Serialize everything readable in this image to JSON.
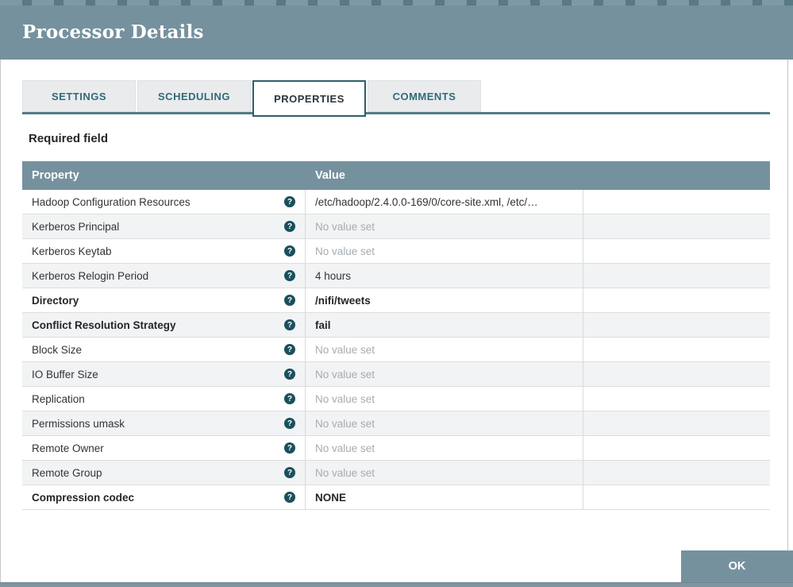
{
  "dialog": {
    "title": "Processor Details",
    "required_note": "Required field",
    "ok_label": "OK"
  },
  "tabs": [
    {
      "label": "SETTINGS",
      "active": false
    },
    {
      "label": "SCHEDULING",
      "active": false
    },
    {
      "label": "PROPERTIES",
      "active": true
    },
    {
      "label": "COMMENTS",
      "active": false
    }
  ],
  "table": {
    "columns": [
      "Property",
      "Value"
    ],
    "rows": [
      {
        "property": "Hadoop Configuration Resources",
        "value": "/etc/hadoop/2.4.0.0-169/0/core-site.xml, /etc/…",
        "required": false,
        "unset": false
      },
      {
        "property": "Kerberos Principal",
        "value": "No value set",
        "required": false,
        "unset": true
      },
      {
        "property": "Kerberos Keytab",
        "value": "No value set",
        "required": false,
        "unset": true
      },
      {
        "property": "Kerberos Relogin Period",
        "value": "4 hours",
        "required": false,
        "unset": false
      },
      {
        "property": "Directory",
        "value": "/nifi/tweets",
        "required": true,
        "unset": false
      },
      {
        "property": "Conflict Resolution Strategy",
        "value": "fail",
        "required": true,
        "unset": false
      },
      {
        "property": "Block Size",
        "value": "No value set",
        "required": false,
        "unset": true
      },
      {
        "property": "IO Buffer Size",
        "value": "No value set",
        "required": false,
        "unset": true
      },
      {
        "property": "Replication",
        "value": "No value set",
        "required": false,
        "unset": true
      },
      {
        "property": "Permissions umask",
        "value": "No value set",
        "required": false,
        "unset": true
      },
      {
        "property": "Remote Owner",
        "value": "No value set",
        "required": false,
        "unset": true
      },
      {
        "property": "Remote Group",
        "value": "No value set",
        "required": false,
        "unset": true
      },
      {
        "property": "Compression codec",
        "value": "NONE",
        "required": true,
        "unset": false
      }
    ]
  },
  "icons": {
    "help_glyph": "?"
  },
  "colors": {
    "header_bg": "#76919E",
    "tab_underline": "#517C8A",
    "tab_text": "#2F6B7A",
    "active_tab_border": "#2D5F6B",
    "row_alt": "#F1F3F4",
    "unset_text": "#A7ACB1",
    "help_icon": "#1A505C",
    "button_bg": "#76919E"
  }
}
